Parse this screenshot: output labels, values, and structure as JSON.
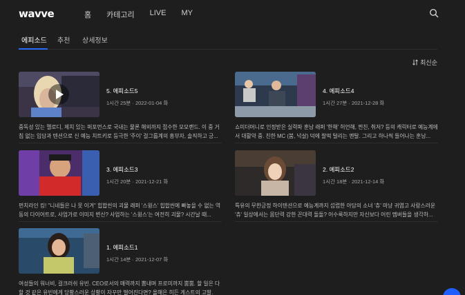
{
  "app": {
    "logo": "wavve"
  },
  "nav": {
    "items": [
      "홈",
      "카테고리",
      "LIVE",
      "MY"
    ]
  },
  "tabs": [
    "에피소드",
    "추천",
    "상세정보"
  ],
  "sort": {
    "label": "최신순"
  },
  "episodes": [
    {
      "title": "5. 에피소드5",
      "sub": "1시간 25분 · 2022-01-04 화",
      "desc": "중독성 있는 멜로디, 제치 있는 퍼포먼스로 국내는 물론 해외까지 접수한 모모랜드. 이 중 거침 없는 입담과 텐션으로 신 예능 치트키로 등극한 '주이' 걸그룹계의 흥부자, 솔직하고 긍..."
    },
    {
      "title": "4. 에피소드4",
      "sub": "1시간 27분 · 2021-12-28 화",
      "desc": "쇼미더머니로 인정받은 실력파 훈남 래퍼 '한해' 허언해, 찐친, 취저? 등의 캐릭터로 예능계에서 대활약 중. 친한 MC (붐, 넉살) 덕에 찰떡 털리는 멘탈. 그리고 하나씩 들어나는 훈남..."
    },
    {
      "title": "3. 에피소드3",
      "sub": "1시간 20분 · 2021-12-21 화",
      "desc": "펀치라인 킹! \"니네들은 나 못 이겨\" 힙합씬의 괴물 래퍼 '스윙스' 힙합씬에 빠놓을 수 없는 역동의 다이어트로, 사업가로 이미지 변신? 사업하는 '스윙스'는 여전히 괴물? 시간날 때..."
    },
    {
      "title": "2. 에피소드2",
      "sub": "1시간 18분 · 2021-12-14 화",
      "desc": "특유의 무한긍정 하이텐션으로 예능계까지 섭렵한 아담의 소녀 '츄' 마냥 귀엽고 사랑스러운 '츄' 일상에서는 몸단력 강한 꼰대력 돌돌? 어수룩하지만 자신보다 어린 멤버들을 생각하..."
    },
    {
      "title": "1. 에피소드1",
      "sub": "1시간 14분 · 2021-12-07 화",
      "desc": "여성들의 워너비, 걸크러쉬 유빈. CEO로서의 매력까지 뽐내며 프로미까지 뿜뿜. 할 일은 다 할 것 같은 유빈에게 당황스러운 상황이 자꾸만 벌어진다면? 올해은 히든 게스트의 고발. 방..."
    }
  ],
  "colors": {
    "accent": "#2a6cff",
    "background": "#1e1e1e"
  }
}
